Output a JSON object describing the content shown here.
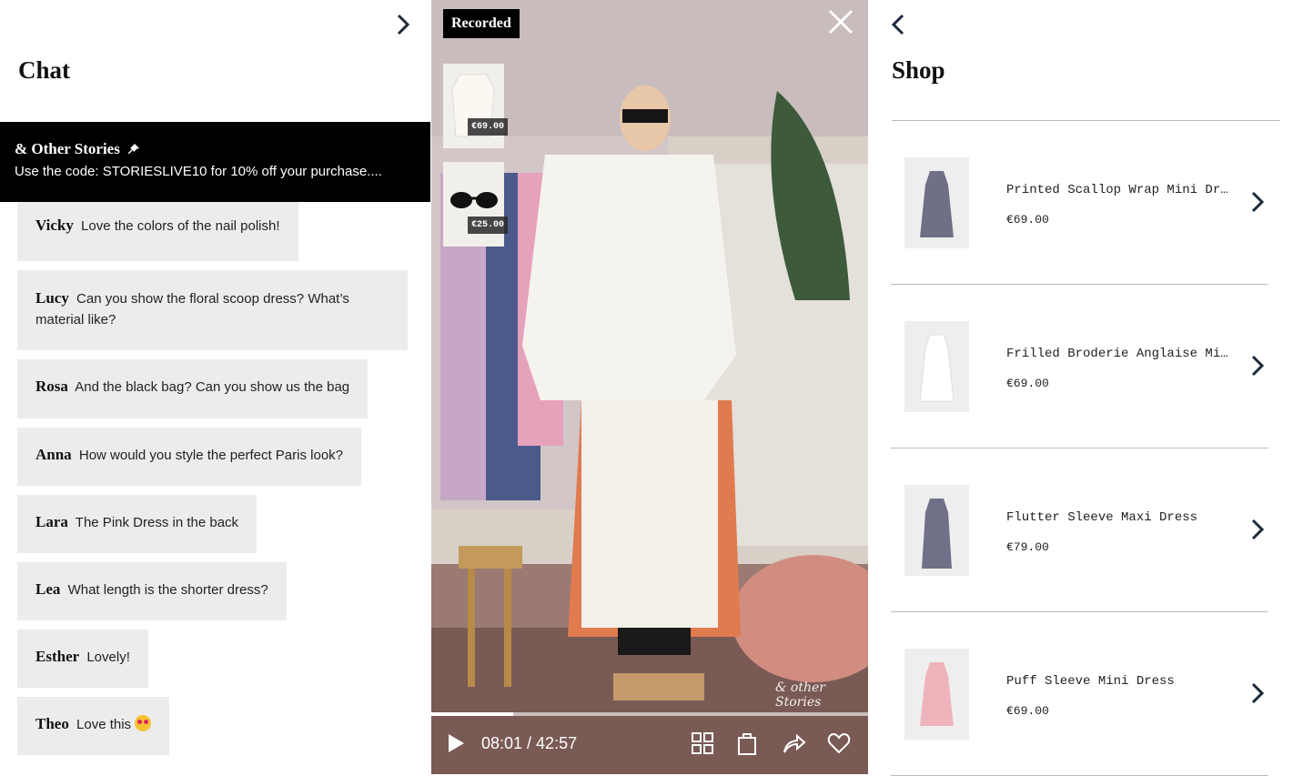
{
  "chat": {
    "title": "Chat",
    "collapse_icon": "chevron-right-icon",
    "pinned": {
      "name": "& Other Stories",
      "text": "Use the code: STORIESLIVE10 for 10% off your purchase...."
    },
    "messages": [
      {
        "author": "Vicky",
        "text": "Love the colors of the nail polish!"
      },
      {
        "author": "Lucy",
        "text": "Can you show the floral scoop dress? What’s material like?"
      },
      {
        "author": "Rosa",
        "text": "And the black bag? Can you show us the bag"
      },
      {
        "author": "Anna",
        "text": "How would you style the perfect Paris look?"
      },
      {
        "author": "Lara",
        "text": "The Pink Dress in the back"
      },
      {
        "author": "Lea",
        "text": "What length is the shorter dress?"
      },
      {
        "author": "Esther",
        "text": "Lovely!"
      },
      {
        "author": "Theo",
        "text": "Love this"
      }
    ]
  },
  "video": {
    "badge": "Recorded",
    "brand_watermark": "& other Stories",
    "time": "08:01 / 42:57",
    "progress": 0.1876,
    "thumbnails": [
      {
        "price": "€69.00",
        "icon": "white-shirt-thumbnail"
      },
      {
        "price": "€25.00",
        "icon": "sunglasses-thumbnail"
      }
    ]
  },
  "shop": {
    "title": "Shop",
    "back_icon": "chevron-left-icon",
    "products": [
      {
        "name": "Printed Scallop Wrap Mini Dress",
        "price": "€69.00",
        "color": "#6f6f86"
      },
      {
        "name": "Frilled Broderie Anglaise Mini Dress",
        "price": "€69.00",
        "color": "#ffffff"
      },
      {
        "name": "Flutter Sleeve Maxi Dress",
        "price": "€79.00",
        "color": "#707088"
      },
      {
        "name": "Puff Sleeve Mini Dress",
        "price": "€69.00",
        "color": "#efb3bb"
      }
    ]
  }
}
